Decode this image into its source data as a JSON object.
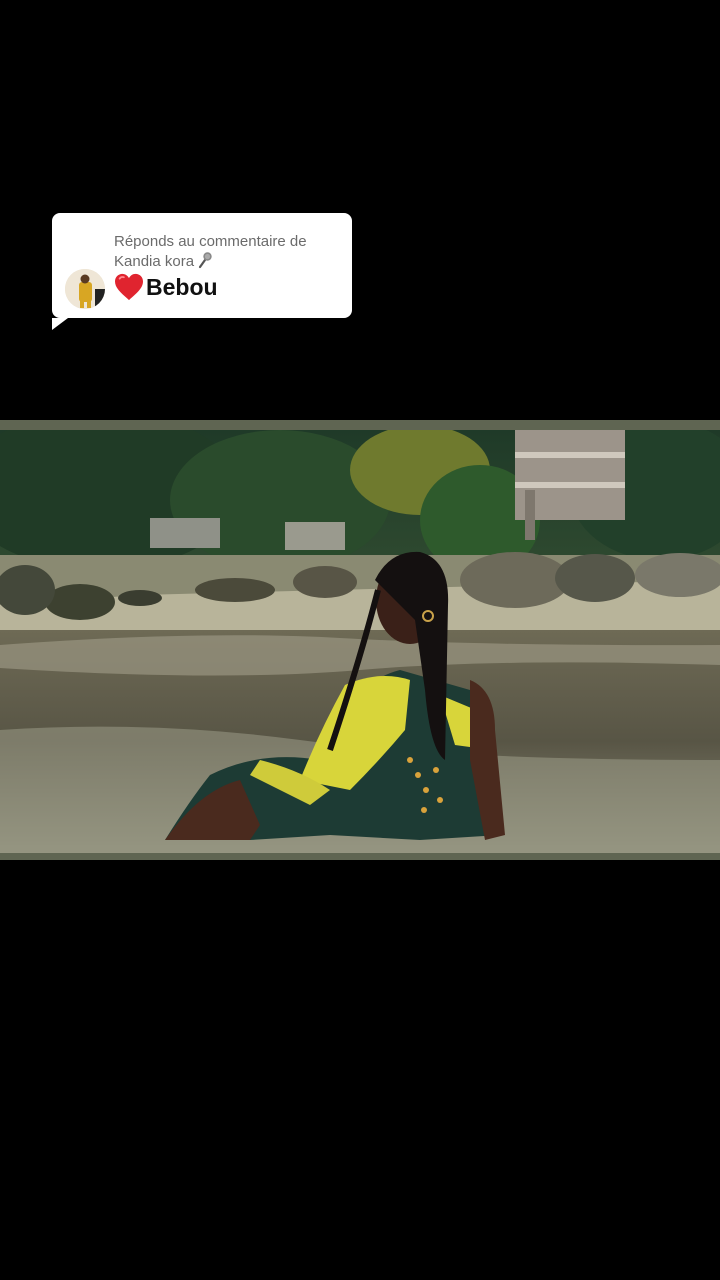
{
  "reply": {
    "header": "Réponds au commentaire de Kandia kora",
    "mic_icon": "microphone-icon",
    "text": "Bebou",
    "heart_icon": "red-heart-icon",
    "heart_color": "#e0242f"
  },
  "video": {
    "description_icon": "video-still"
  },
  "colors": {
    "background": "#000000",
    "card": "#ffffff",
    "frame_border": "#5f6552"
  }
}
